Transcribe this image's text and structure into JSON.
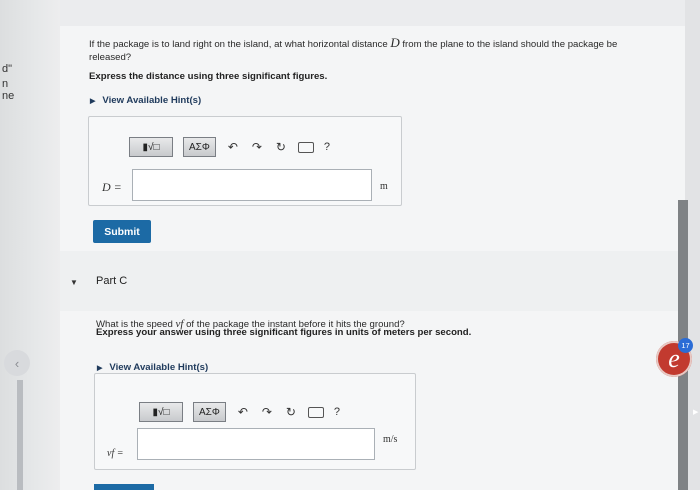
{
  "gutter": {
    "fragments": [
      "d\"",
      "n",
      "ne"
    ],
    "prev_arrow": "‹"
  },
  "part_b": {
    "question_before": "If the package is to land right on the island, at what horizontal distance ",
    "question_var": "D",
    "question_after": " from the plane to the island should the package be released?",
    "instruction": "Express the distance using three significant figures.",
    "hint_label": "View Available Hint(s)",
    "toolbar": {
      "templates_glyph": "▮√□",
      "greek": "ΑΣΦ",
      "help": "?"
    },
    "var_label": "D =",
    "input_value": "",
    "unit": "m",
    "submit_label": "Submit"
  },
  "part_c": {
    "title": "Part C",
    "question_before": "What is the speed ",
    "question_var": "vf",
    "question_after": " of the package the instant before it hits the ground?",
    "instruction": "Express your answer using three significant figures in units of meters per second.",
    "hint_label": "View Available Hint(s)",
    "toolbar": {
      "templates_glyph": "▮√□",
      "greek": "ΑΣΦ",
      "help": "?"
    },
    "var_label": "vf =",
    "input_value": "",
    "unit": "m/s"
  },
  "overlay": {
    "badge_letter": "e",
    "badge_count": "17"
  },
  "colors": {
    "accent": "#1c6aa5",
    "badge": "#c23a2f",
    "count": "#2b6cd6"
  }
}
